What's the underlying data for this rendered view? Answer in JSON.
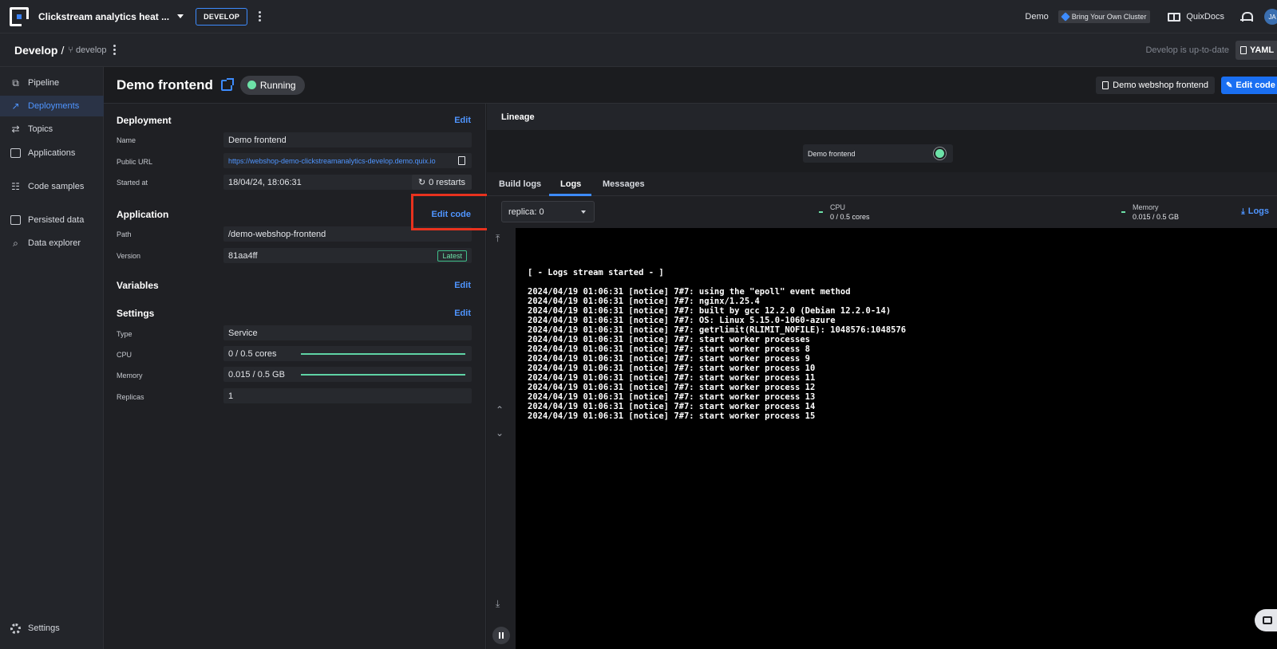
{
  "topbar": {
    "workspace": "Clickstream analytics heat ...",
    "environment_button": "DEVELOP",
    "demo_label": "Demo",
    "byoc_label": "Bring Your Own Cluster",
    "docs_label": "QuixDocs",
    "avatar_initials": "JA"
  },
  "subbar": {
    "breadcrumb": "Develop",
    "separator": "/",
    "branch": "develop",
    "status": "Develop is up-to-date",
    "yaml_button": "YAML"
  },
  "sidebar": {
    "items": [
      {
        "label": "Pipeline",
        "icon": "pipeline-icon",
        "active": false
      },
      {
        "label": "Deployments",
        "icon": "rocket-icon",
        "active": true
      },
      {
        "label": "Topics",
        "icon": "topics-icon",
        "active": false
      },
      {
        "label": "Applications",
        "icon": "applications-icon",
        "active": false
      },
      {
        "label": "Code samples",
        "icon": "code-samples-icon",
        "active": false
      },
      {
        "label": "Persisted data",
        "icon": "persisted-data-icon",
        "active": false
      },
      {
        "label": "Data explorer",
        "icon": "data-explorer-icon",
        "active": false
      }
    ],
    "settings_label": "Settings"
  },
  "header": {
    "title": "Demo frontend",
    "status": "Running",
    "project_link": "Demo webshop frontend",
    "edit_code_button": "Edit code"
  },
  "deployment": {
    "title": "Deployment",
    "edit_label": "Edit",
    "name_label": "Name",
    "name_value": "Demo frontend",
    "url_label": "Public URL",
    "url_value": "https://webshop-demo-clickstreamanalytics-develop.demo.quix.io",
    "started_label": "Started at",
    "started_value": "18/04/24, 18:06:31",
    "restarts": "0 restarts"
  },
  "application": {
    "title": "Application",
    "edit_code_label": "Edit code",
    "path_label": "Path",
    "path_value": "/demo-webshop-frontend",
    "version_label": "Version",
    "version_value": "81aa4ff",
    "version_badge": "Latest"
  },
  "variables": {
    "title": "Variables",
    "edit_label": "Edit"
  },
  "settings": {
    "title": "Settings",
    "edit_label": "Edit",
    "type_label": "Type",
    "type_value": "Service",
    "cpu_label": "CPU",
    "cpu_value": "0 / 0.5 cores",
    "memory_label": "Memory",
    "memory_value": "0.015 / 0.5 GB",
    "replicas_label": "Replicas",
    "replicas_value": "1"
  },
  "lineage": {
    "title": "Lineage",
    "node_label": "Demo frontend"
  },
  "tabs": [
    {
      "label": "Build logs",
      "active": false
    },
    {
      "label": "Logs",
      "active": true
    },
    {
      "label": "Messages",
      "active": false
    }
  ],
  "logs": {
    "replica_select": "replica: 0",
    "cpu_label": "CPU",
    "cpu_value": "0 / 0.5 cores",
    "memory_label": "Memory",
    "memory_value": "0.015 / 0.5 GB",
    "download_label": "Logs",
    "lines": [
      "[ - Logs stream started - ]",
      "2024/04/19 01:06:31 [notice] 7#7: using the \"epoll\" event method",
      "2024/04/19 01:06:31 [notice] 7#7: nginx/1.25.4",
      "2024/04/19 01:06:31 [notice] 7#7: built by gcc 12.2.0 (Debian 12.2.0-14)",
      "2024/04/19 01:06:31 [notice] 7#7: OS: Linux 5.15.0-1060-azure",
      "2024/04/19 01:06:31 [notice] 7#7: getrlimit(RLIMIT_NOFILE): 1048576:1048576",
      "2024/04/19 01:06:31 [notice] 7#7: start worker processes",
      "2024/04/19 01:06:31 [notice] 7#7: start worker process 8",
      "2024/04/19 01:06:31 [notice] 7#7: start worker process 9",
      "2024/04/19 01:06:31 [notice] 7#7: start worker process 10",
      "2024/04/19 01:06:31 [notice] 7#7: start worker process 11",
      "2024/04/19 01:06:31 [notice] 7#7: start worker process 12",
      "2024/04/19 01:06:31 [notice] 7#7: start worker process 13",
      "2024/04/19 01:06:31 [notice] 7#7: start worker process 14",
      "2024/04/19 01:06:31 [notice] 7#7: start worker process 15"
    ]
  },
  "colors": {
    "accent": "#3d8bfd",
    "running": "#6de2a8",
    "highlight_box": "#e8321e"
  }
}
